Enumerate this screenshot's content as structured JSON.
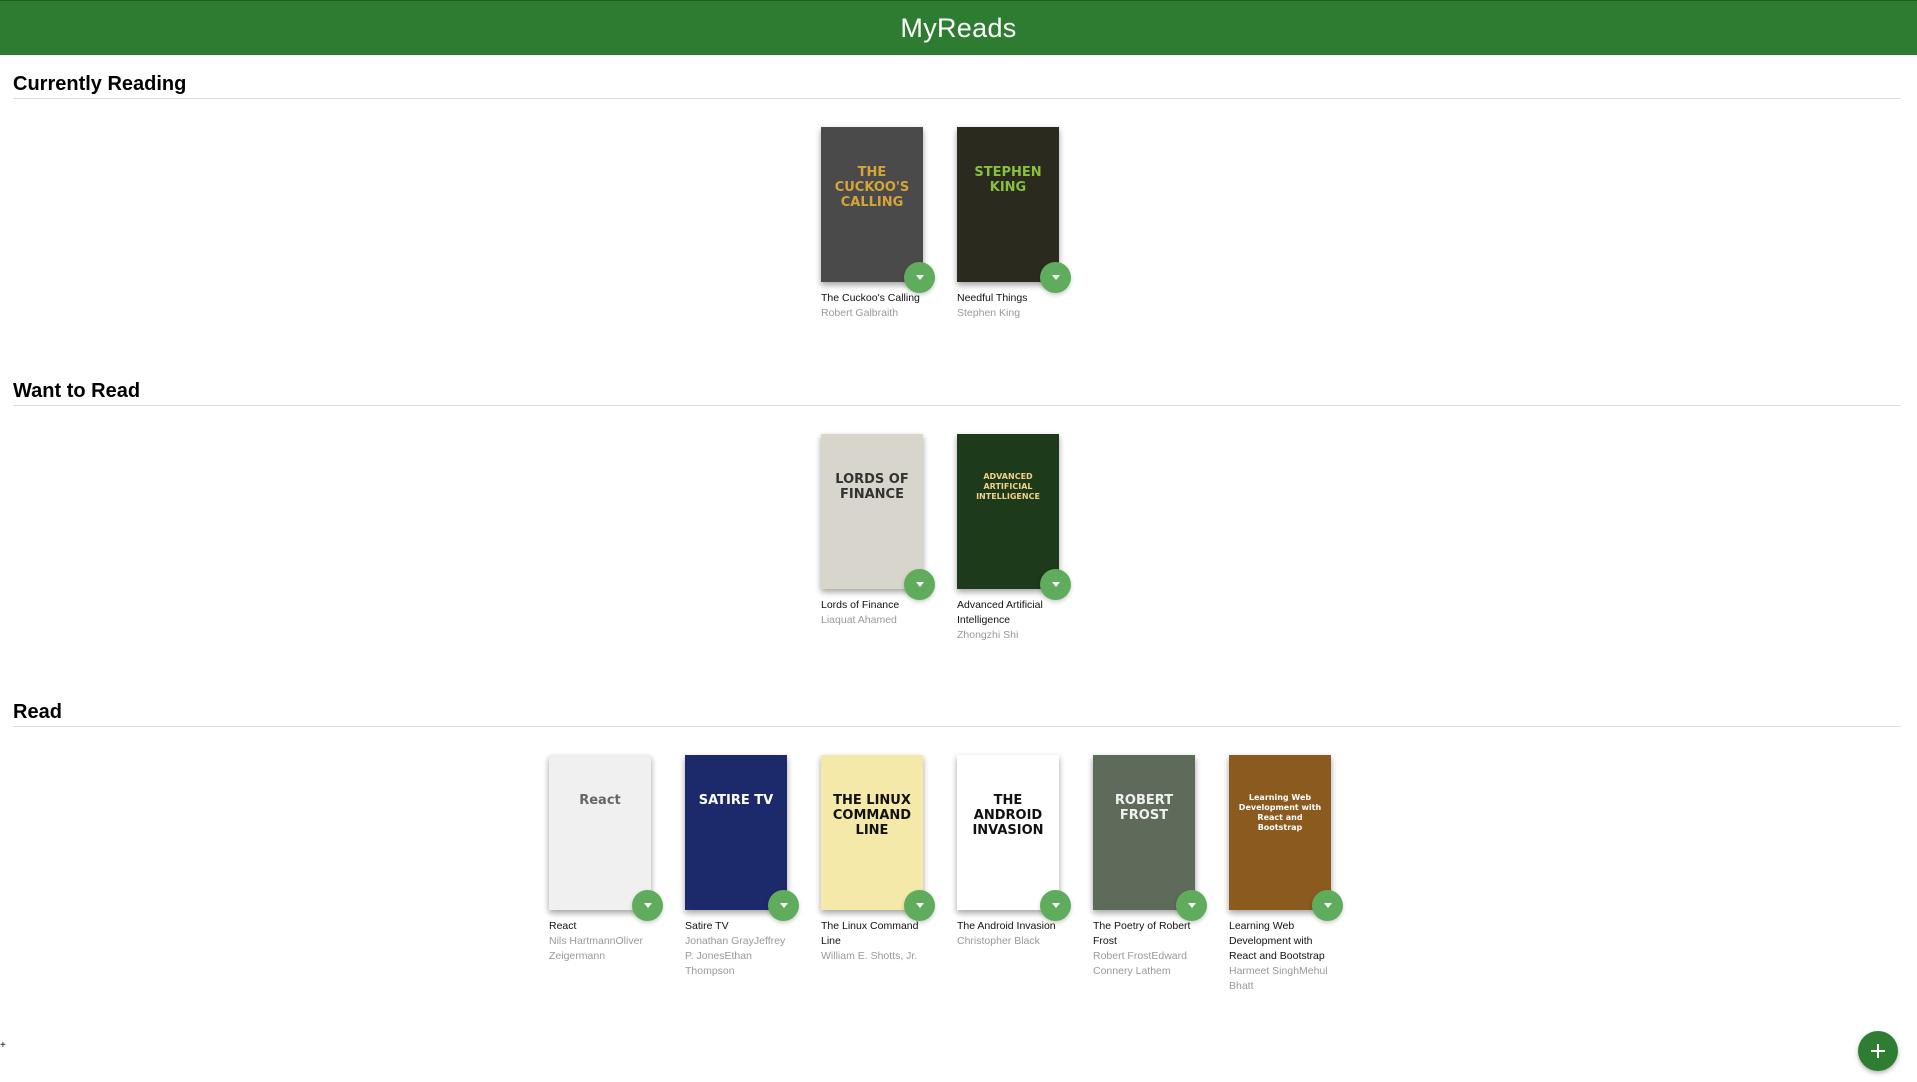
{
  "app": {
    "title": "MyReads"
  },
  "shelves": [
    {
      "title": "Currently Reading",
      "books": [
        {
          "title": "The Cuckoo's Calling",
          "authors": "Robert Galbraith",
          "cover_text": "THE CUCKOO'S CALLING",
          "cover_bg": "#4a4a4a",
          "cover_fg": "#d6a53a"
        },
        {
          "title": "Needful Things",
          "authors": "Stephen King",
          "cover_text": "STEPHEN KING",
          "cover_bg": "#2a2a1e",
          "cover_fg": "#86c23b"
        }
      ]
    },
    {
      "title": "Want to Read",
      "books": [
        {
          "title": "Lords of Finance",
          "authors": "Liaquat Ahamed",
          "cover_text": "LORDS OF FINANCE",
          "cover_bg": "#d8d6cc",
          "cover_fg": "#333333"
        },
        {
          "title": "Advanced Artificial Intelligence",
          "authors": "Zhongzhi Shi",
          "cover_text": "ADVANCED ARTIFICIAL INTELLIGENCE",
          "cover_bg": "#1d3a1a",
          "cover_fg": "#f2d08a"
        }
      ]
    },
    {
      "title": "Read",
      "books": [
        {
          "title": "React",
          "authors": "Nils HartmannOliver Zeigermann",
          "cover_text": "React",
          "cover_bg": "#f0f0f0",
          "cover_fg": "#666666"
        },
        {
          "title": "Satire TV",
          "authors": "Jonathan GrayJeffrey P. JonesEthan Thompson",
          "cover_text": "SATIRE TV",
          "cover_bg": "#1c2a6b",
          "cover_fg": "#ffffff"
        },
        {
          "title": "The Linux Command Line",
          "authors": "William E. Shotts, Jr.",
          "cover_text": "THE LINUX COMMAND LINE",
          "cover_bg": "#f4e9a8",
          "cover_fg": "#111111"
        },
        {
          "title": "The Android Invasion",
          "authors": "Christopher Black",
          "cover_text": "THE ANDROID INVASION",
          "cover_bg": "#ffffff",
          "cover_fg": "#111111"
        },
        {
          "title": "The Poetry of Robert Frost",
          "authors": "Robert FrostEdward Connery Lathem",
          "cover_text": "ROBERT FROST",
          "cover_bg": "#5e6b5a",
          "cover_fg": "#f0f0f0"
        },
        {
          "title": "Learning Web Development with React and Bootstrap",
          "authors": "Harmeet SinghMehul Bhatt",
          "cover_text": "Learning Web Development with React and Bootstrap",
          "cover_bg": "#8a5a1e",
          "cover_fg": "#ffffff"
        }
      ]
    }
  ],
  "colors": {
    "header": "#2e7c31",
    "shelf_changer": "#60ac5d",
    "add_button": "#2e7d32"
  },
  "icons": {
    "shelf_changer": "chevron-down-icon",
    "add": "plus-icon"
  }
}
